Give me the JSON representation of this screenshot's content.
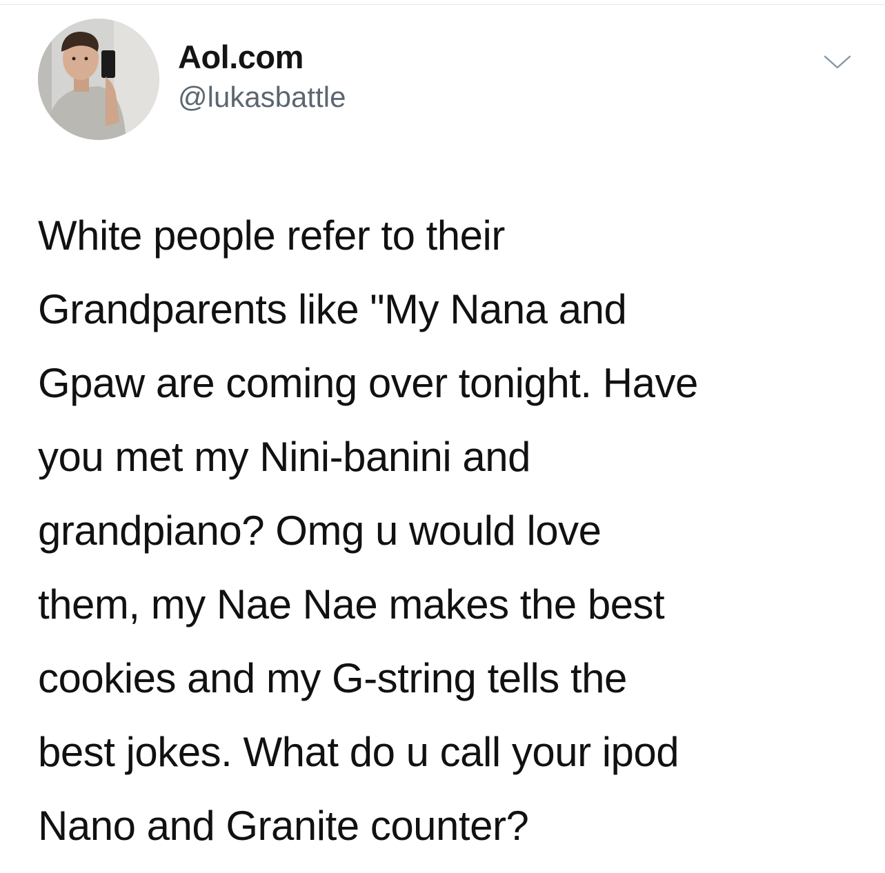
{
  "tweet": {
    "author": {
      "display_name": "Aol.com",
      "handle": "@lukasbattle",
      "avatar_icon": "profile-photo-avatar"
    },
    "menu_icon": "chevron-down-icon",
    "text_lines": [
      "White people refer to their",
      "Grandparents like \"My Nana and",
      "Gpaw are coming over tonight. Have",
      "you met my Nini-banini and",
      "grandpiano? Omg u would love",
      "them, my Nae Nae makes the best",
      "cookies and my G-string tells the",
      "best jokes. What do u call your ipod",
      "Nano and Granite counter?"
    ]
  },
  "colors": {
    "background": "#ffffff",
    "text": "#111111",
    "handle": "#5b6670",
    "chevron": "#8899a6"
  }
}
